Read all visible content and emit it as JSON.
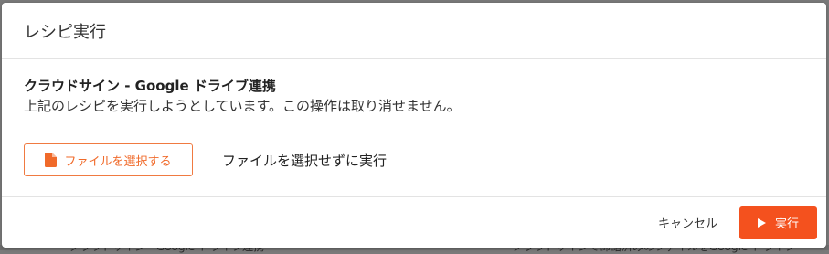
{
  "backdrop": {
    "left_text": "クラウドサイン - Google ドライブ連携",
    "right_text": "クラウドサインで締結済みのファイルをGoogle ドライブ"
  },
  "modal": {
    "title": "レシピ実行",
    "recipe_name": "クラウドサイン - Google ドライブ連携",
    "description": "上記のレシピを実行しようとしています。この操作は取り消せません。",
    "select_file_label": "ファイルを選択する",
    "run_without_file_label": "ファイルを選択せずに実行",
    "cancel_label": "キャンセル",
    "run_label": "実行"
  },
  "colors": {
    "accent": "#f4511e",
    "accent_outline": "#f07a41"
  },
  "icons": {
    "select_file": "file-icon",
    "run": "play-icon"
  }
}
